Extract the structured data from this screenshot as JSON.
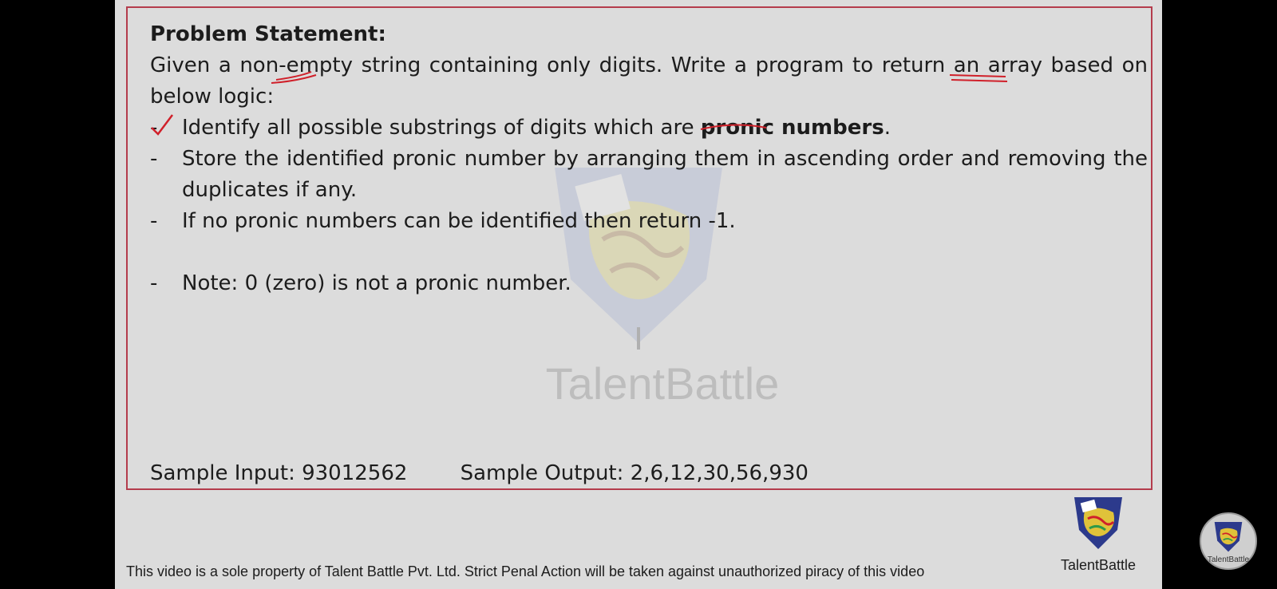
{
  "slide": {
    "title": "Problem Statement:",
    "intro": "Given a non-empty string containing only digits. Write a program to return an array based on below logic:",
    "bullets": [
      {
        "dash": "-",
        "before": "Identify all possible substrings of digits which are ",
        "bold": "pronic numbers",
        "after": "."
      },
      {
        "dash": "-",
        "text": "Store the identified pronic number by arranging them in ascending order and removing the duplicates if any."
      },
      {
        "dash": "-",
        "text": "If no pronic numbers can be identified then return -1."
      },
      {
        "dash": "-",
        "text": "Note: 0 (zero) is not a pronic number."
      }
    ],
    "sample_input": "Sample Input: 93012562",
    "sample_output": "Sample Output: 2,6,12,30,56,930",
    "watermark": "TalentBattle"
  },
  "footer": {
    "notice": "This video is a sole property of Talent Battle Pvt. Ltd. Strict Penal Action will be taken against unauthorized piracy of this video",
    "logo_text": "TalentBattle"
  },
  "channel": {
    "avatar_text": "TalentBattle"
  },
  "colors": {
    "background": "#000000",
    "slide": "#dcdcdc",
    "frame_border": "#b43c4c",
    "annotation": "#d0202a"
  }
}
